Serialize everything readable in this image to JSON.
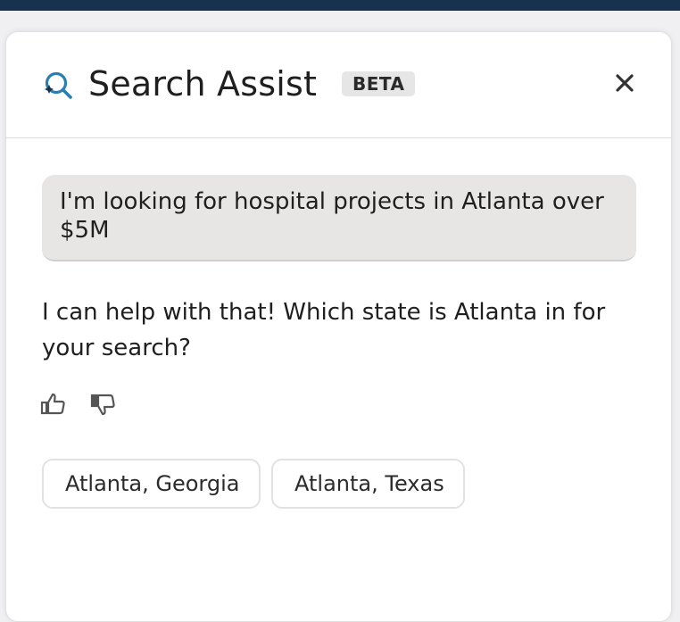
{
  "header": {
    "title": "Search Assist",
    "badge": "BETA",
    "brand_icon": "search-assist-icon",
    "close_icon": "close-icon"
  },
  "conversation": {
    "user_message": "I'm looking for hospital projects in Atlanta over $5M",
    "assistant_message": "I can help with that! Which state is Atlanta in for your search?",
    "feedback": {
      "thumbs_up_icon": "thumbs-up-icon",
      "thumbs_down_icon": "thumbs-down-icon"
    },
    "suggestions": [
      {
        "label": "Atlanta, Georgia"
      },
      {
        "label": "Atlanta, Texas"
      }
    ]
  },
  "colors": {
    "top_bar": "#16324f",
    "brand_icon": "#2a7fb0",
    "user_bubble": "#e7e6e5",
    "badge_bg": "#e6e6e6"
  }
}
